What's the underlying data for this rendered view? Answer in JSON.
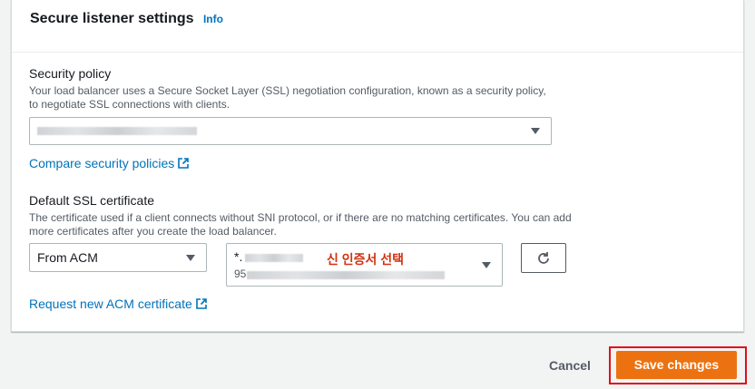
{
  "section": {
    "title": "Secure listener settings",
    "info_link": "Info"
  },
  "security_policy": {
    "label": "Security policy",
    "description_line1": "Your load balancer uses a Secure Socket Layer (SSL) negotiation configuration, known as a security policy,",
    "description_line2": "to negotiate SSL connections with clients.",
    "compare_link": "Compare security policies"
  },
  "ssl_certificate": {
    "label": "Default SSL certificate",
    "description_line1": "The certificate used if a client connects without SNI protocol, or if there are no matching certificates. You can add",
    "description_line2": "more certificates after you create the load balancer.",
    "source_selected": "From ACM",
    "certificate_domain_prefix": "*.",
    "certificate_id_prefix": "95",
    "annotation": "신 인증서 선택",
    "request_link": "Request new ACM certificate"
  },
  "footer": {
    "cancel_label": "Cancel",
    "save_label": "Save changes"
  },
  "colors": {
    "primary_button": "#ec7211",
    "link": "#0073bb",
    "annotation": "#d13212",
    "highlight": "#e0101a"
  },
  "icons": [
    "external-link-icon",
    "refresh-icon",
    "caret-down-icon"
  ]
}
